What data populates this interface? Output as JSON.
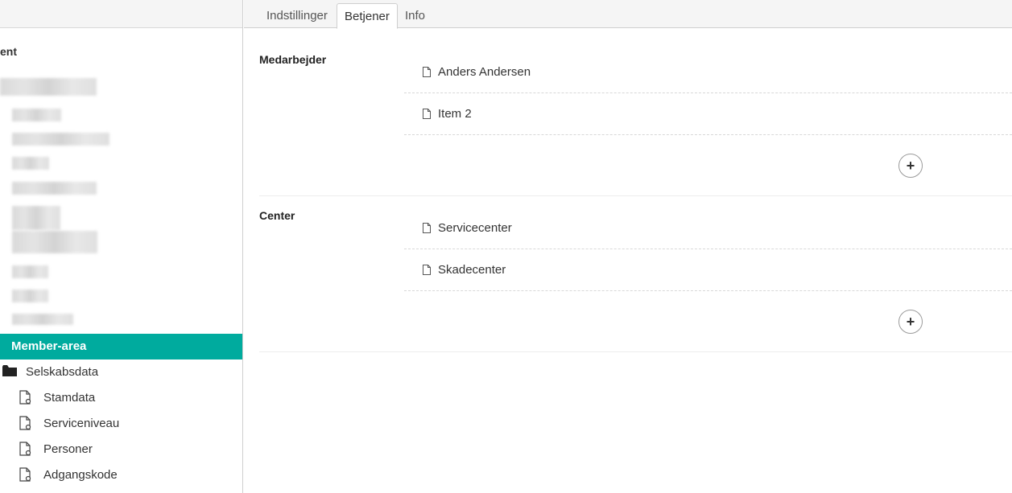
{
  "sidebar": {
    "root_label": "ent",
    "selected": "Member-area",
    "folder": "Selskabsdata",
    "children": [
      "Stamdata",
      "Serviceniveau",
      "Personer",
      "Adgangskode"
    ]
  },
  "tabs": [
    {
      "label": "Indstillinger"
    },
    {
      "label": "Betjener"
    },
    {
      "label": "Info"
    }
  ],
  "sections": [
    {
      "label": "Medarbejder",
      "items": [
        "Anders Andersen",
        "Item 2"
      ]
    },
    {
      "label": "Center",
      "items": [
        "Servicecenter",
        "Skadecenter"
      ]
    }
  ],
  "add_label": "+"
}
